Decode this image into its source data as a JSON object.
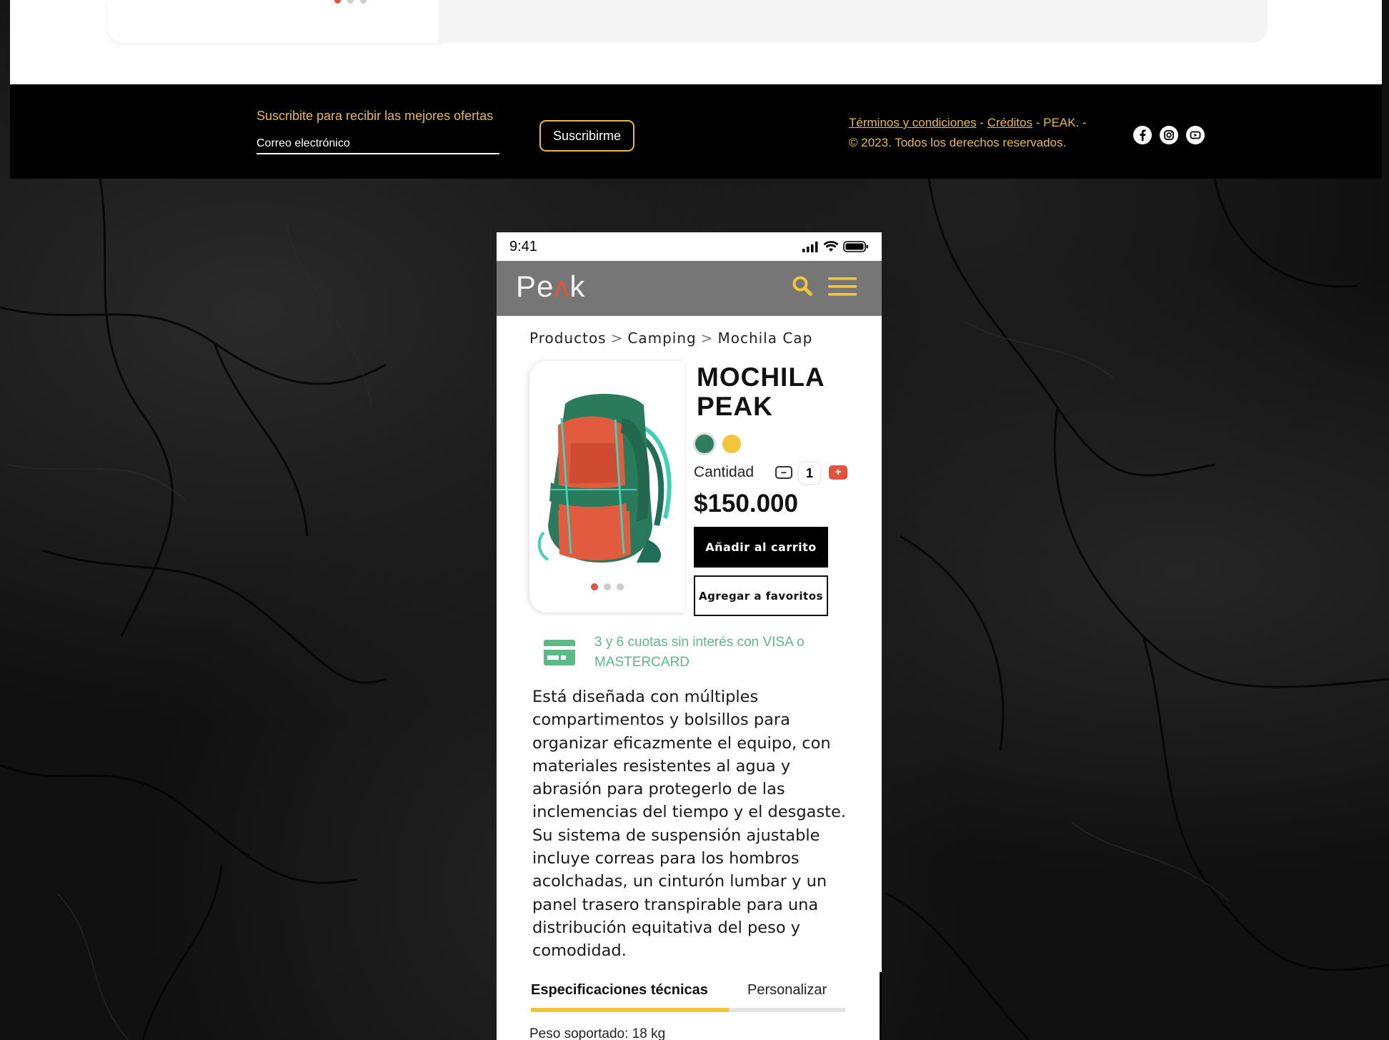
{
  "footer": {
    "subscribe_label": "Suscribite para recibir las mejores ofertas",
    "email_placeholder": "Correo electrónico",
    "subscribe_button": "Suscribirme",
    "terms_link": "Términos y condiciones",
    "credits_link": "Créditos",
    "brand_suffix": " - PEAK. -",
    "copyright": "© 2023. Todos los derechos reservados.",
    "socials": [
      "facebook-icon",
      "instagram-icon",
      "youtube-icon"
    ]
  },
  "phone": {
    "status": {
      "time": "9:41"
    },
    "logo": {
      "pre": "Pe",
      "accent": "ʌ",
      "post": "k"
    },
    "breadcrumb": [
      "Productos",
      "Camping",
      "Mochila Cap"
    ],
    "breadcrumb_sep": ">",
    "product": {
      "title": "MOCHILA PEAK",
      "colors": [
        "#2e7d5e",
        "#f2c53d"
      ],
      "quantity_label": "Cantidad",
      "quantity": "1",
      "price": "$150.000",
      "add_to_cart": "Añadir al carrito",
      "add_to_favorites": "Agregar a favoritos",
      "installments": "3 y 6 cuotas sin interés con VISA o MASTERCARD",
      "description": "Está diseñada con múltiples compartimentos y bolsillos para organizar eficazmente el equipo, con materiales resistentes al agua y abrasión para protegerlo de las inclemencias del tiempo y el desgaste. Su sistema de suspensión ajustable incluye correas para los hombros acolchadas, un cinturón lumbar y un panel trasero transpirable para una distribución equitativa del peso y comodidad."
    },
    "tabs": [
      {
        "label": "Especificaciones técnicas",
        "active": true
      },
      {
        "label": "Personalizar",
        "active": false
      }
    ],
    "spec_line": "Peso soportado: 18 kg"
  },
  "colors": {
    "accent_yellow": "#e7b94c",
    "accent_red": "#e0533d",
    "installments_green": "#5cba87",
    "nav_gray": "#767676"
  }
}
